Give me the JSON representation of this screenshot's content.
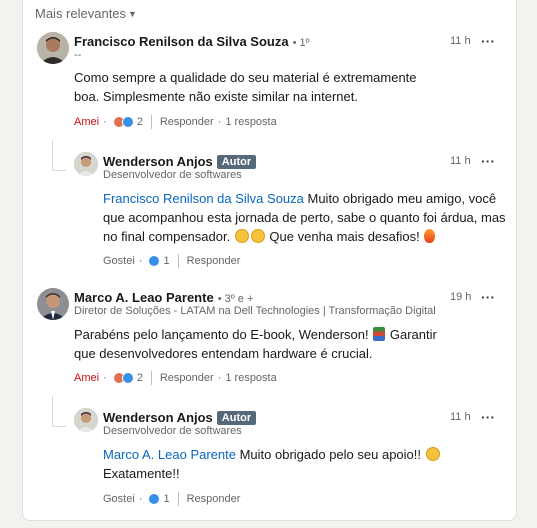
{
  "sort_label": "Mais relevantes",
  "comments": [
    {
      "author": "Francisco Renilson da Silva Souza",
      "degree": "• 1º",
      "headline": "--",
      "time": "11 h",
      "text": "Como sempre a qualidade do seu material é extremamente boa. Simplesmente não existe similar na internet.",
      "reaction_label": "Amei",
      "reaction_count": "2",
      "reply_label": "Responder",
      "replies_count": "1 resposta",
      "reply": {
        "author": "Wenderson Anjos",
        "badge": "Autor",
        "headline": "Desenvolvedor de softwares",
        "time": "11 h",
        "mention": "Francisco Renilson da Silva Souza",
        "text_1": " Muito obrigado meu amigo, você que acompanhou esta jornada de perto, sabe o quanto foi árdua, mas no final compensador. ",
        "text_2": " Que venha mais desafios! ",
        "reaction_label": "Gostei",
        "reaction_count": "1",
        "reply_label": "Responder"
      }
    },
    {
      "author": "Marco A. Leao Parente",
      "degree": "• 3º e +",
      "headline": "Diretor de Soluções - LATAM na Dell Technologies | Transformação Digital",
      "time": "19 h",
      "text_1": "Parabéns pelo lançamento do E-book, Wenderson! ",
      "text_2": " Garantir que desenvolvedores entendam hardware é crucial.",
      "reaction_label": "Amei",
      "reaction_count": "2",
      "reply_label": "Responder",
      "replies_count": "1 resposta",
      "reply": {
        "author": "Wenderson Anjos",
        "badge": "Autor",
        "headline": "Desenvolvedor de softwares",
        "time": "11 h",
        "mention": "Marco A. Leao Parente",
        "text_1": " Muito obrigado pelo seu apoio!! ",
        "text_2": "Exatamente!!",
        "reaction_label": "Gostei",
        "reaction_count": "1",
        "reply_label": "Responder"
      }
    }
  ],
  "colors": {
    "mention": "#0a66c2",
    "liked": "#cc1016",
    "badge": "#56687a"
  }
}
